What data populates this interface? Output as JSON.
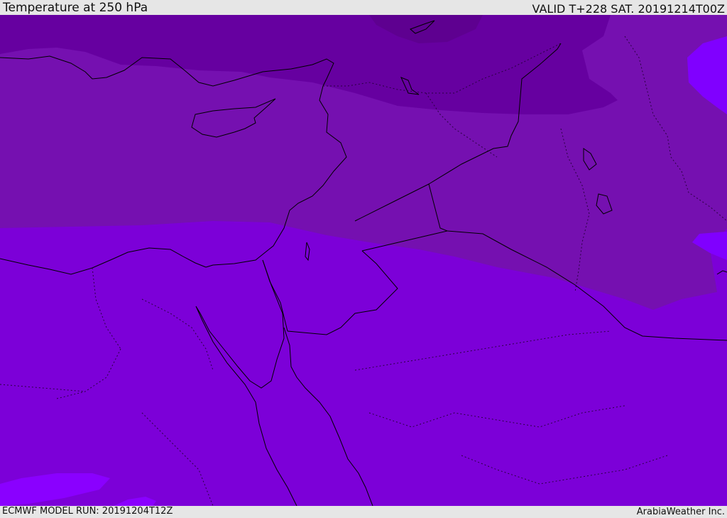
{
  "header": {
    "title": "Temperature at 250 hPa",
    "valid": "VALID T+228 SAT. 20191214T00Z"
  },
  "footer": {
    "model_run": "ECMWF MODEL RUN: 20191204T12Z",
    "credit": "ArabiaWeather Inc."
  },
  "colors": {
    "band_coldest": "#5e0090",
    "band_cold": "#6600a0",
    "band_mid": "#7510b0",
    "band_warm": "#7c00d8",
    "band_warmer": "#8a00ff",
    "band_warmest": "#7a00ff",
    "coastline": "#000000",
    "border": "#2a0040",
    "chrome_bg": "#e6e6e6"
  }
}
